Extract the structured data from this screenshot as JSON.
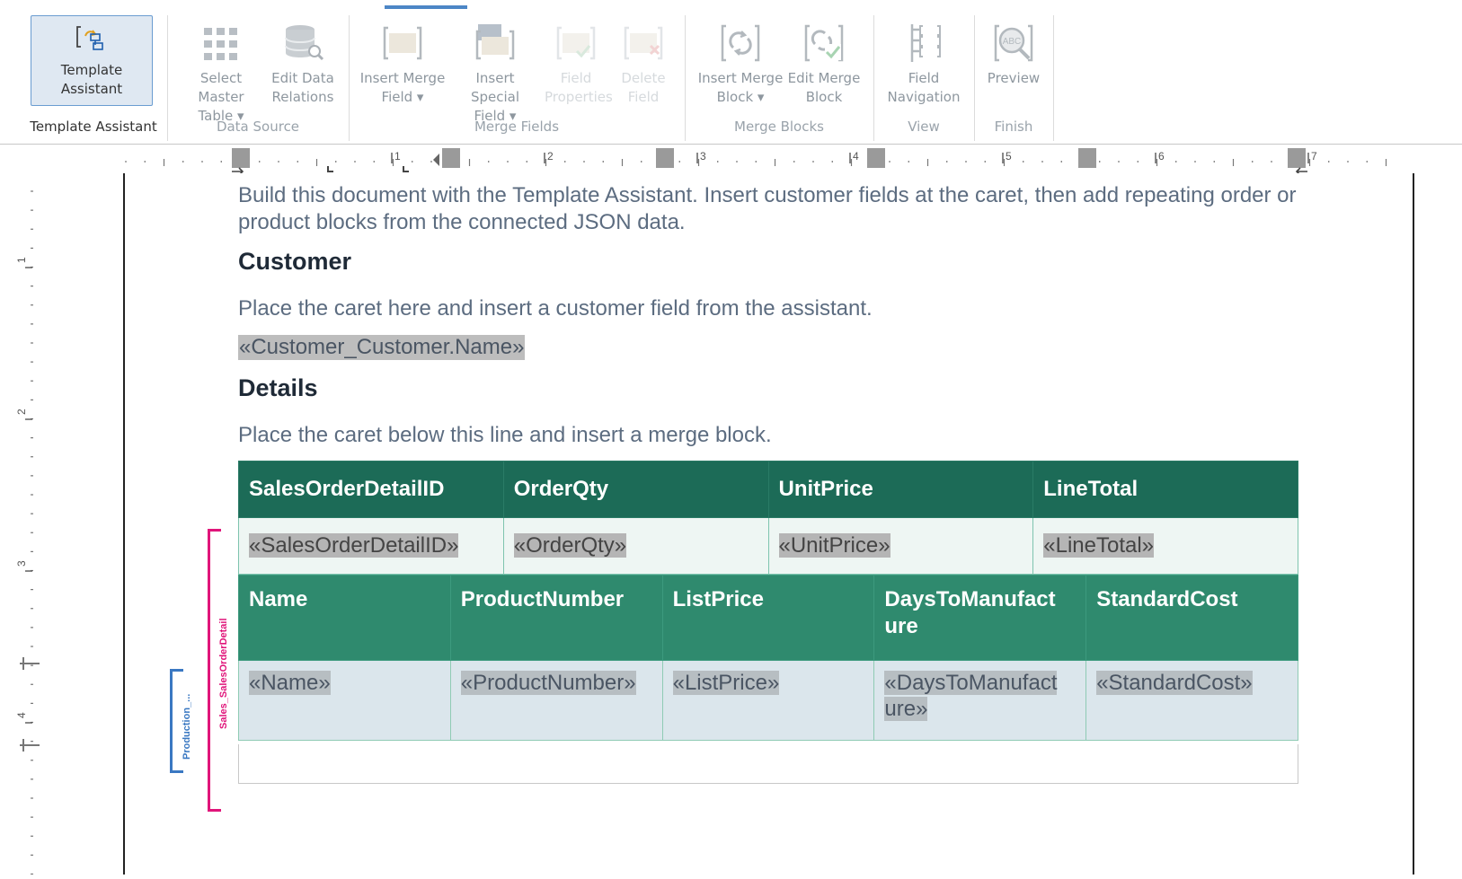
{
  "ribbon": {
    "groups": {
      "template_assistant": "Template Assistant",
      "data_source": "Data Source",
      "merge_fields": "Merge Fields",
      "merge_blocks": "Merge Blocks",
      "view": "View",
      "finish": "Finish"
    },
    "buttons": {
      "template_assistant": "Template Assistant",
      "select_master_table": "Select Master\nTable ▾",
      "edit_data_relations": "Edit Data\nRelations",
      "insert_merge_field": "Insert Merge\nField ▾",
      "insert_special_field": "Insert Special\nField ▾",
      "field_properties": "Field\nProperties",
      "delete_field": "Delete\nField",
      "insert_merge_block": "Insert Merge\nBlock ▾",
      "edit_merge_block": "Edit Merge\nBlock",
      "field_navigation": "Field\nNavigation",
      "preview": "Preview"
    },
    "preview_icon_text": "ABC"
  },
  "ruler": {
    "h_numbers": [
      "1",
      "2",
      "3",
      "4",
      "5",
      "6",
      "7"
    ],
    "v_numbers": [
      "1",
      "2",
      "3",
      "4"
    ]
  },
  "document": {
    "intro": "Build this document with the Template Assistant. Insert customer fields at the caret, then add repeating order or product blocks from the connected JSON data.",
    "customer_heading": "Customer",
    "customer_instruction": "Place the caret here and insert a customer field from the assistant.",
    "customer_field": "«Customer_Customer.Name»",
    "details_heading": "Details",
    "details_instruction": "Place the caret below this line and insert a merge block.",
    "order_table": {
      "headers": [
        "SalesOrderDetailID",
        "OrderQty",
        "UnitPrice",
        "LineTotal"
      ],
      "fields": [
        "«SalesOrderDetailID»",
        "«OrderQty»",
        "«UnitPrice»",
        "«LineTotal»"
      ]
    },
    "product_table": {
      "headers": [
        "Name",
        "ProductNumber",
        "ListPrice",
        "DaysToManufact\nure",
        "StandardCost"
      ],
      "fields": [
        "«Name»",
        "«ProductNumber»",
        "«ListPrice»",
        "«DaysToManufact\nure»",
        "«StandardCost»"
      ]
    },
    "blocks": {
      "outer": "Sales_SalesOrderDetail",
      "inner": "Production_..."
    }
  },
  "colors": {
    "header_dark": "#1c6b57",
    "header_mid": "#2f8a6e",
    "outer_block": "#e0157a",
    "inner_block": "#3a78c2"
  }
}
